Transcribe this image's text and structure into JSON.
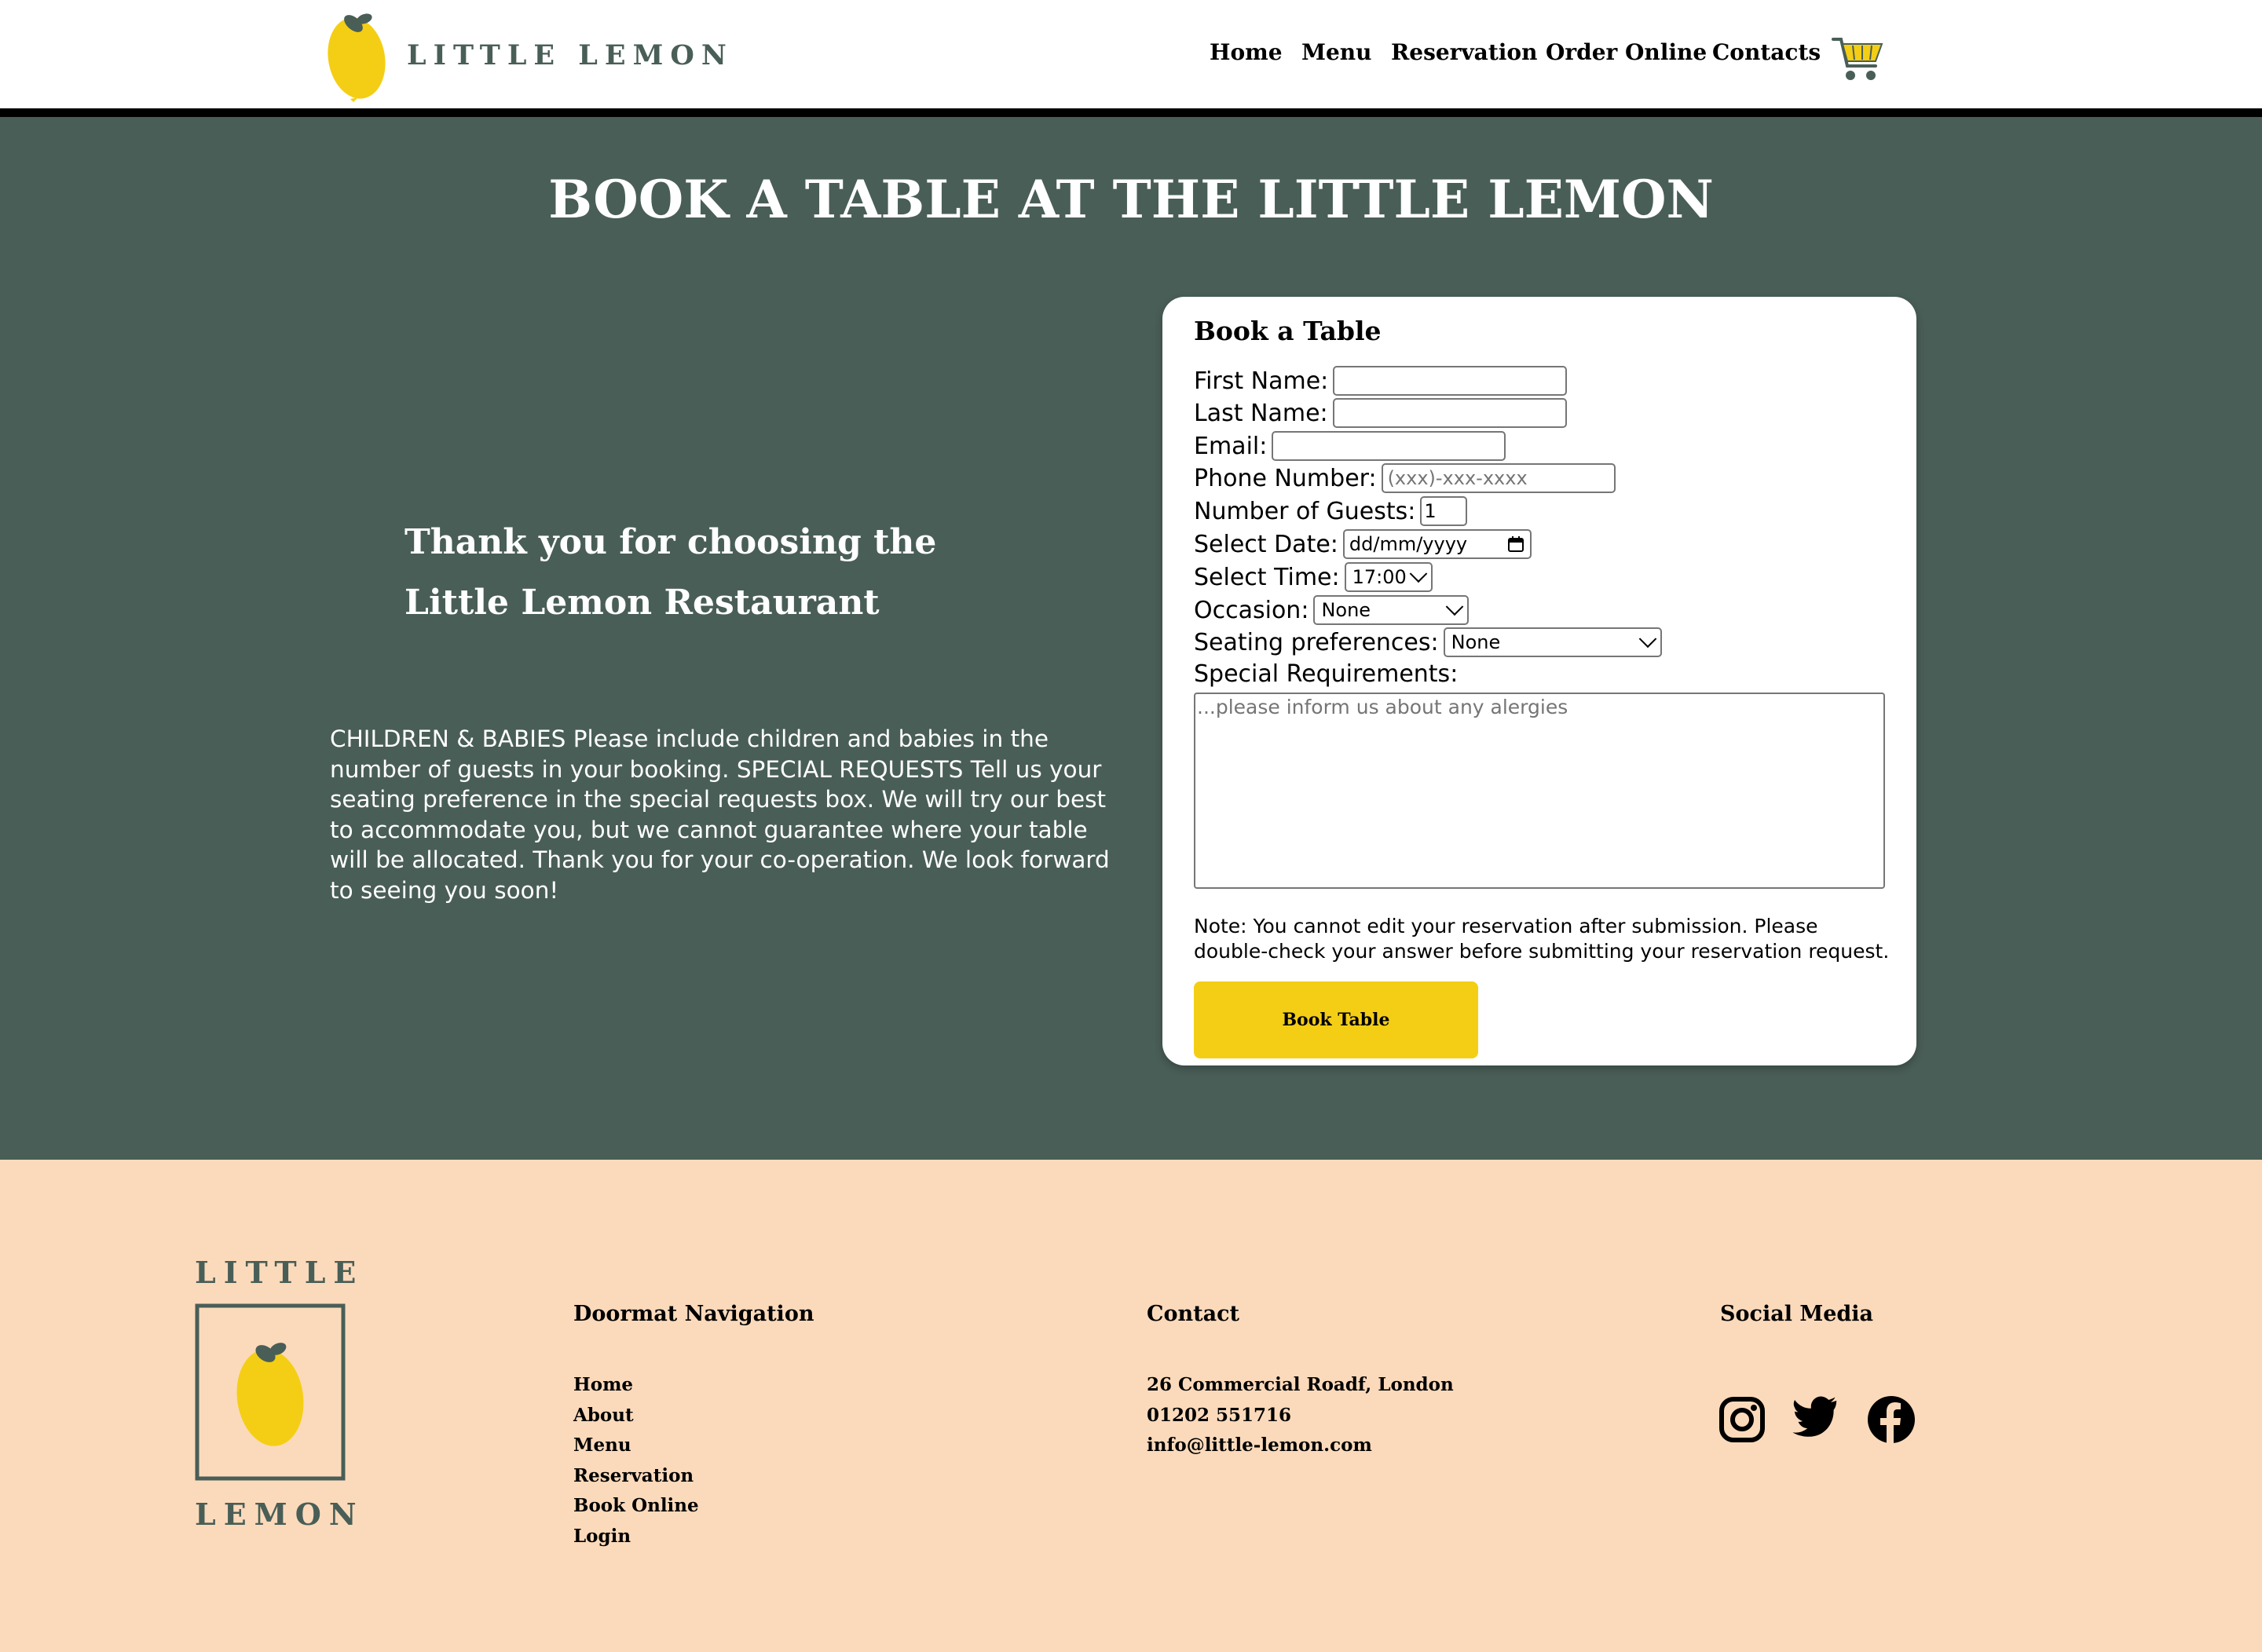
{
  "header": {
    "logo_text": "LITTLE LEMON",
    "nav": [
      "Home",
      "Menu",
      "Reservation",
      "Order Online",
      "Contacts"
    ],
    "cart_icon": "cart-icon"
  },
  "hero": {
    "title": "BOOK A TABLE AT THE LITTLE LEMON",
    "thanks": "Thank you for choosing the Little Lemon Restaurant",
    "info": "CHILDREN & BABIES Please include children and babies in the number of guests in your booking. SPECIAL REQUESTS Tell us your seating preference in the special requests box. We will try our best to accommodate you, but we cannot guarantee where your table will be allocated. Thank you for your co-operation. We look forward to seeing you soon!"
  },
  "form": {
    "title": "Book a Table",
    "first_name_label": "First Name:",
    "last_name_label": "Last Name:",
    "email_label": "Email:",
    "phone_label": "Phone Number:",
    "phone_placeholder": "(xxx)-xxx-xxxx",
    "guests_label": "Number of Guests:",
    "guests_value": "1",
    "date_label": "Select Date:",
    "date_value": "dd/mm/yyyy",
    "time_label": "Select Time:",
    "time_value": "17:00",
    "occasion_label": "Occasion:",
    "occasion_value": "None",
    "seating_label": "Seating preferences:",
    "seating_value": "None",
    "special_label": "Special Requirements:",
    "special_placeholder": "...please inform us about any alergies",
    "note": "Note: You cannot edit your reservation after submission. Please double-check your answer before submitting your reservation request.",
    "submit": "Book Table"
  },
  "footer": {
    "logo_top": "LITTLE",
    "logo_bottom": "LEMON",
    "doormat_heading": "Doormat Navigation",
    "doormat_links": [
      "Home",
      "About",
      "Menu",
      "Reservation",
      "Book Online",
      "Login"
    ],
    "contact_heading": "Contact",
    "contact_lines": [
      "26 Commercial Roadf, London",
      "01202 551716",
      "info@little-lemon.com"
    ],
    "social_heading": "Social Media",
    "social_icons": [
      "instagram-icon",
      "twitter-icon",
      "facebook-icon"
    ]
  },
  "colors": {
    "primary_green": "#495e57",
    "primary_yellow": "#f4ce14",
    "footer_peach": "#fbdabb"
  }
}
